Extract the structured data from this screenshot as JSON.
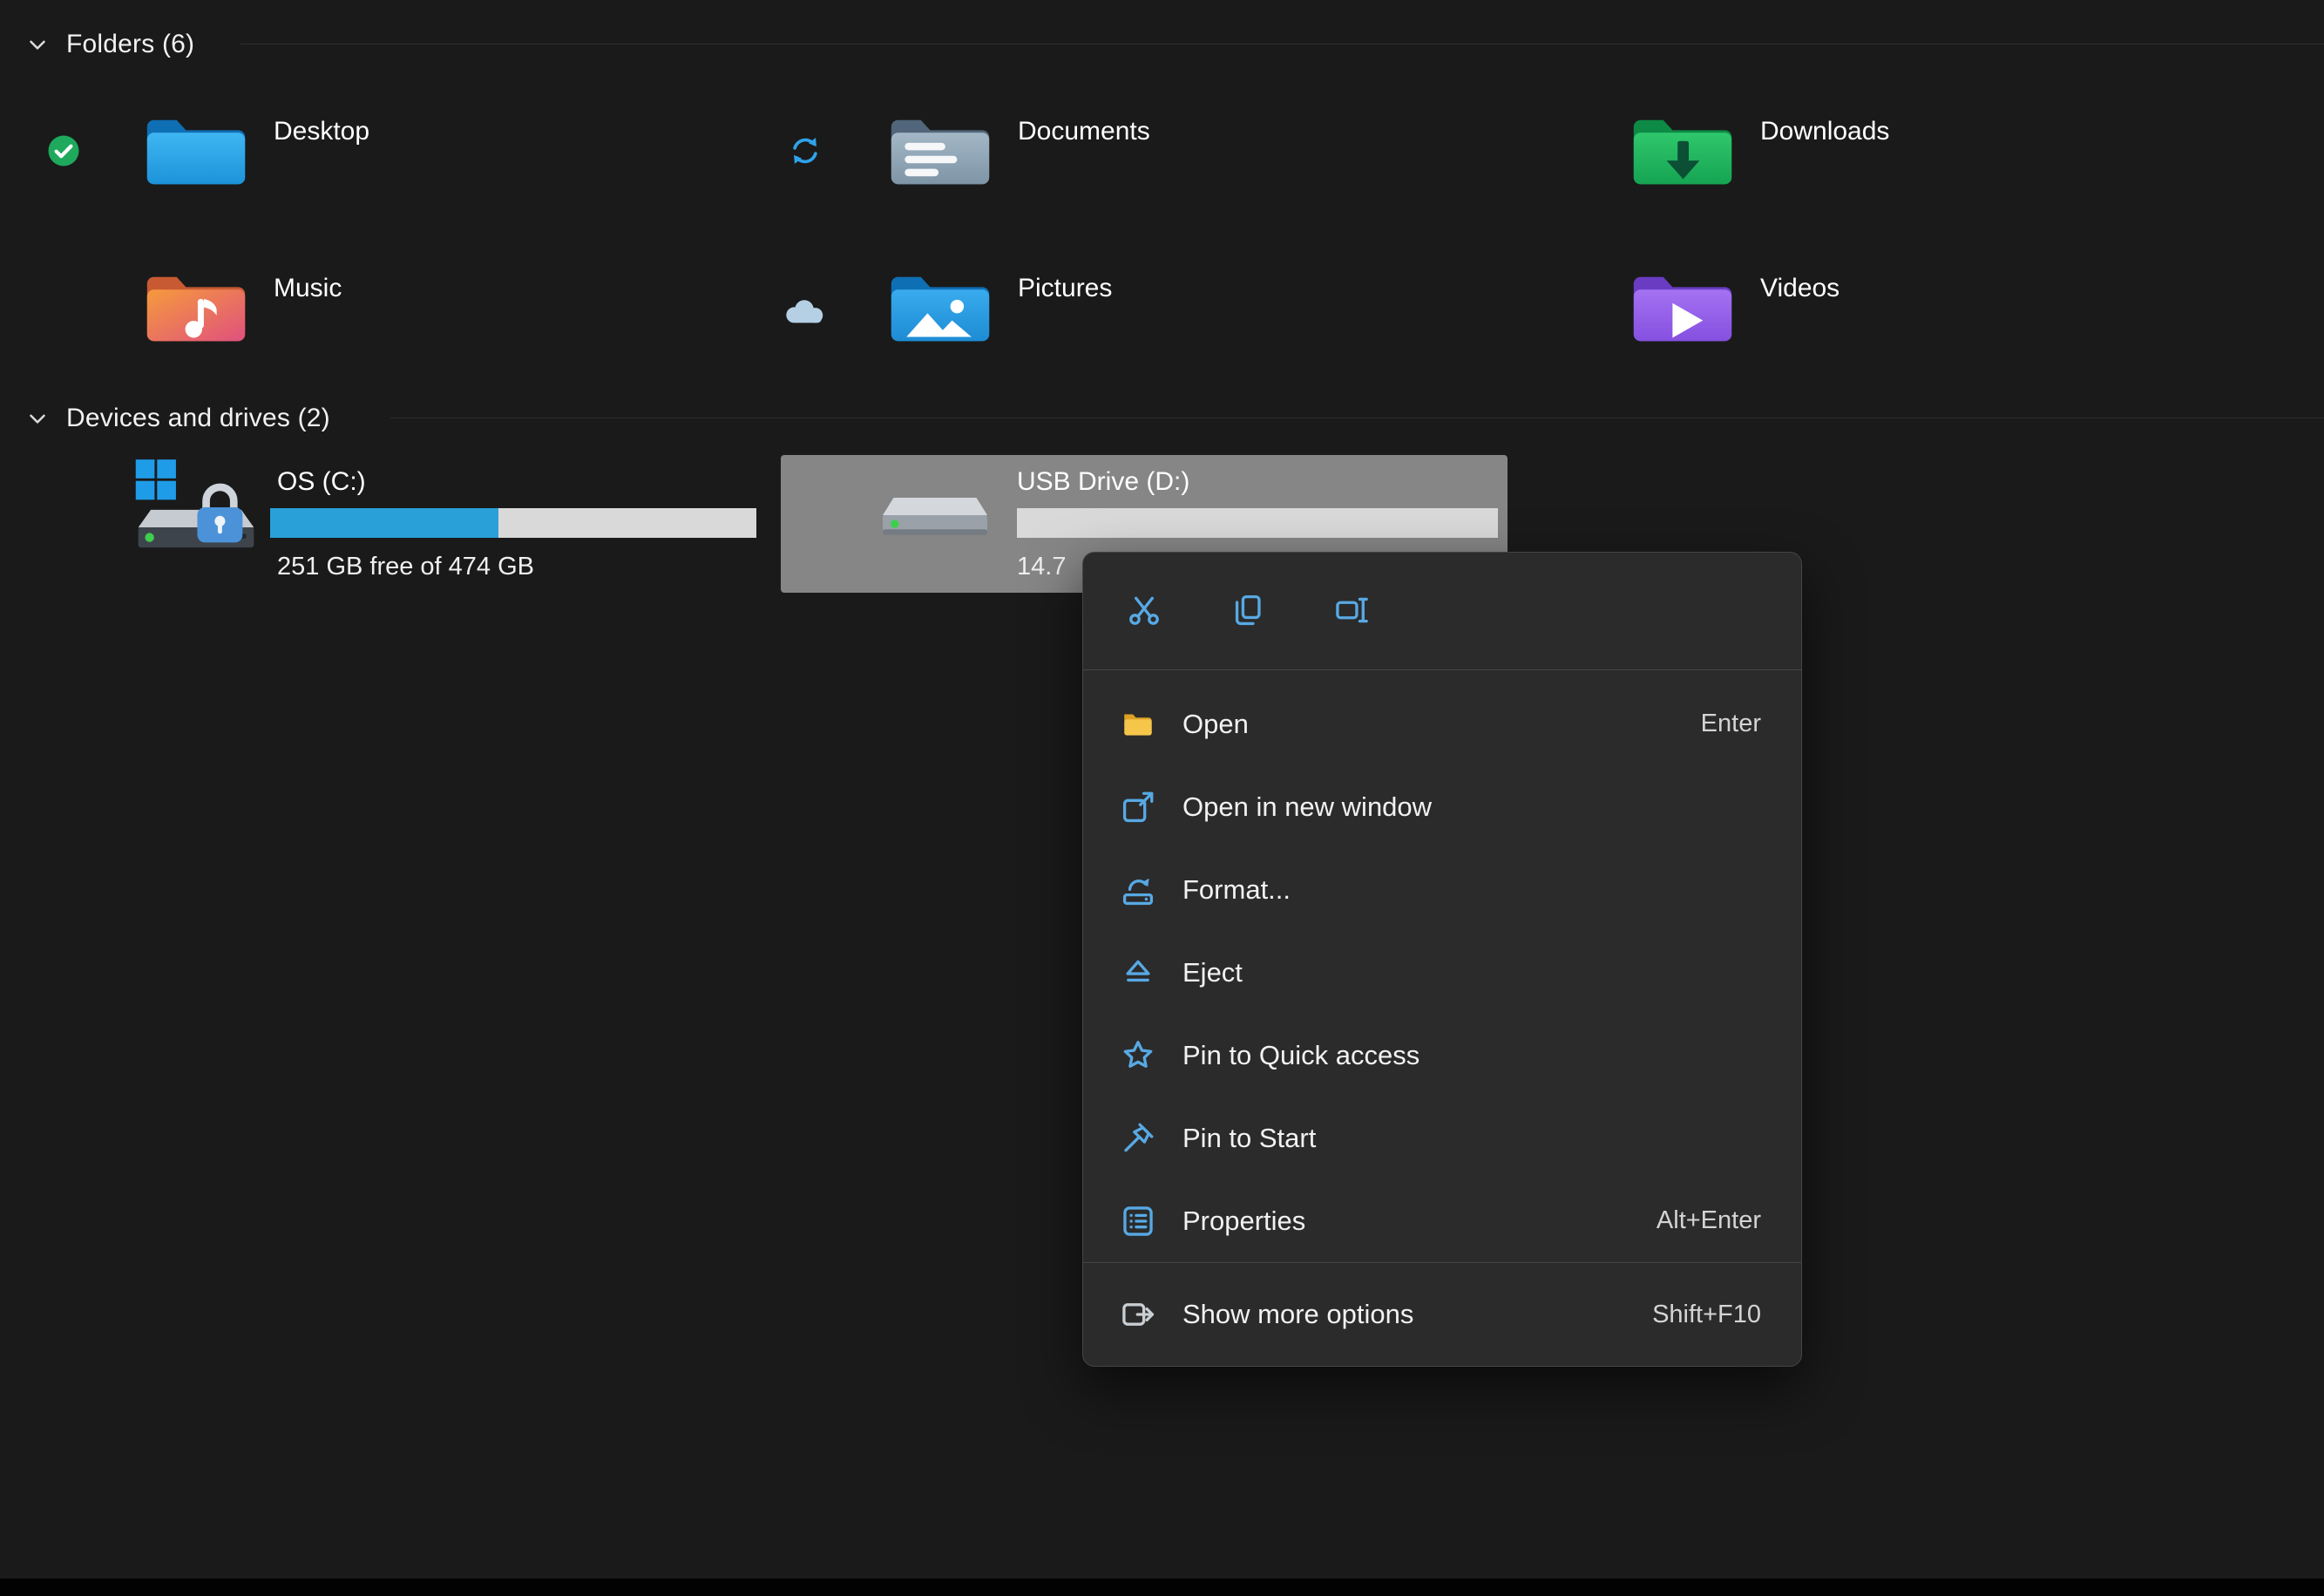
{
  "sections": {
    "folders": {
      "title": "Folders (6)"
    },
    "devices": {
      "title": "Devices and drives (2)"
    }
  },
  "folders": [
    {
      "label": "Desktop",
      "status": "synced"
    },
    {
      "label": "Documents",
      "status": "syncing"
    },
    {
      "label": "Downloads",
      "status": ""
    },
    {
      "label": "Music",
      "status": ""
    },
    {
      "label": "Pictures",
      "status": "cloud"
    },
    {
      "label": "Videos",
      "status": ""
    }
  ],
  "drives": [
    {
      "label": "OS (C:)",
      "detail": "251 GB free of 474 GB",
      "used_percent": 47,
      "selected": false
    },
    {
      "label": "USB Drive (D:)",
      "detail": "14.7",
      "used_percent": 0,
      "selected": true
    }
  ],
  "context_menu": {
    "quick_actions": [
      {
        "name": "Cut"
      },
      {
        "name": "Copy"
      },
      {
        "name": "Rename"
      }
    ],
    "items": [
      {
        "label": "Open",
        "shortcut": "Enter"
      },
      {
        "label": "Open in new window",
        "shortcut": ""
      },
      {
        "label": "Format...",
        "shortcut": ""
      },
      {
        "label": "Eject",
        "shortcut": ""
      },
      {
        "label": "Pin to Quick access",
        "shortcut": ""
      },
      {
        "label": "Pin to Start",
        "shortcut": ""
      },
      {
        "label": "Properties",
        "shortcut": "Alt+Enter"
      }
    ],
    "footer": {
      "label": "Show more options",
      "shortcut": "Shift+F10"
    }
  },
  "colors": {
    "background": "#1a1a1a",
    "selection": "#868686",
    "accent": "#57a9e4",
    "bar_fill": "#29a0d8",
    "bar_track": "#d9d9d9",
    "menu_background": "#2b2b2b"
  }
}
